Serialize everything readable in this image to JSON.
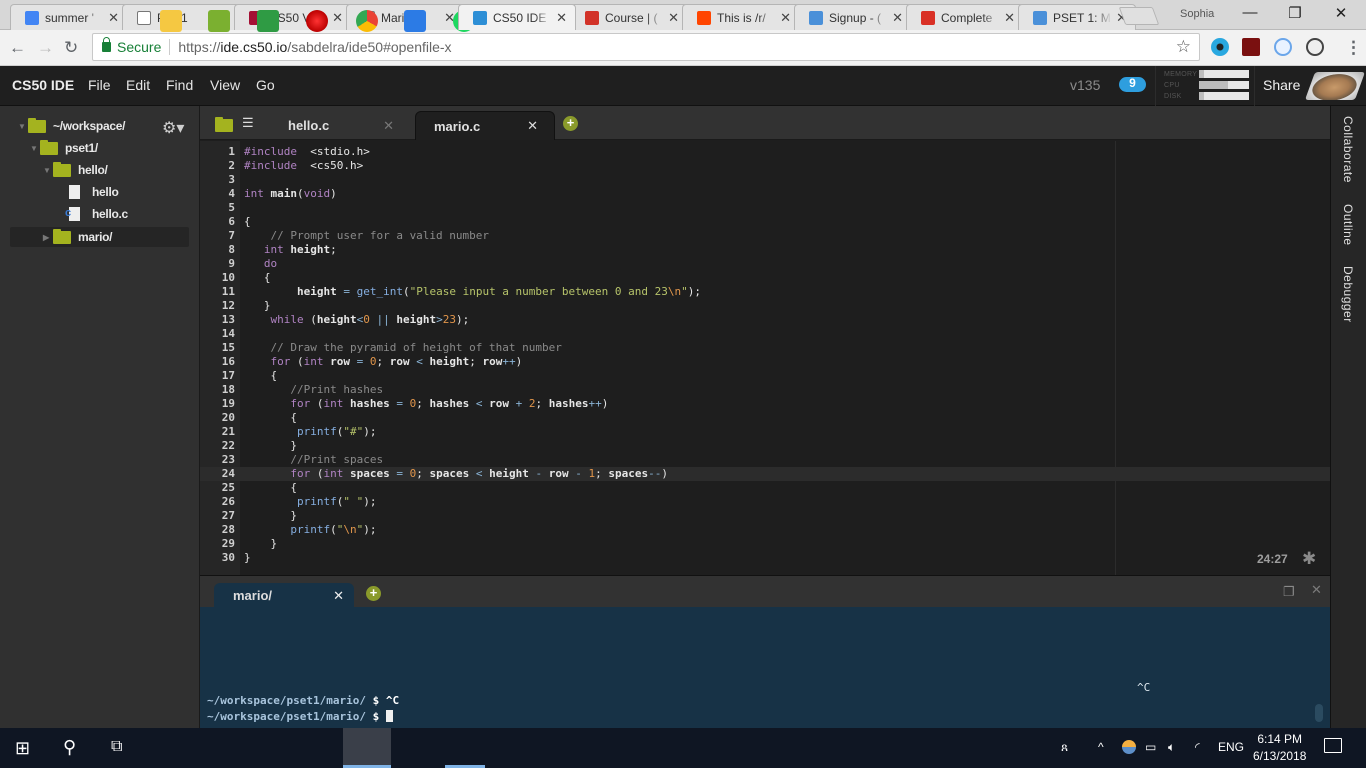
{
  "browser": {
    "tabs": [
      {
        "title": "summer '",
        "favicon": "docs-icon",
        "color": "#4285f4"
      },
      {
        "title": "Pset1",
        "favicon": "page-icon",
        "color": "#ffffff"
      },
      {
        "title": "CS50 Vide",
        "favicon": "harvard-shield-icon",
        "color": "#a41034"
      },
      {
        "title": "Mario",
        "favicon": "page-icon",
        "color": "#ffffff"
      },
      {
        "title": "CS50 IDE",
        "favicon": "cloud9-icon",
        "color": "#2e8fd6",
        "active": true
      },
      {
        "title": "Course | (",
        "favicon": "edx-icon",
        "color": "#d23228"
      },
      {
        "title": "This is /r/",
        "favicon": "reddit-icon",
        "color": "#ff4500"
      },
      {
        "title": "Signup - (",
        "favicon": "x-icon",
        "color": "#4a90d9"
      },
      {
        "title": "Complete",
        "favicon": "gmail-icon",
        "color": "#d93025"
      },
      {
        "title": "PSET 1: M",
        "favicon": "x-icon",
        "color": "#4a90d9"
      }
    ],
    "profile_name": "Sophia",
    "window_controls": {
      "minimize": "—",
      "maximize": "❐",
      "close": "✕"
    },
    "secure_label": "Secure",
    "url_prefix": "https://",
    "url_host": "ide.cs50.io",
    "url_path": "/sabdelra/ide50#openfile-x"
  },
  "ide": {
    "brand": "CS50 IDE",
    "menus": [
      "File",
      "Edit",
      "Find",
      "View",
      "Go"
    ],
    "version": "v135",
    "cloud_badge": "9",
    "meters": [
      {
        "label": "MEMORY",
        "value": 0.1
      },
      {
        "label": "CPU",
        "value": 0.58
      },
      {
        "label": "DISK",
        "value": 0.1
      }
    ],
    "share_label": "Share"
  },
  "tree": {
    "root": "~/workspace/",
    "items": [
      {
        "label": "pset1/",
        "type": "folder",
        "expanded": true
      },
      {
        "label": "hello/",
        "type": "folder",
        "expanded": true
      },
      {
        "label": "hello",
        "type": "file"
      },
      {
        "label": "hello.c",
        "type": "c-file"
      },
      {
        "label": "mario/",
        "type": "folder",
        "expanded": false,
        "selected": true
      }
    ]
  },
  "editor": {
    "tabs": [
      {
        "label": "hello.c",
        "active": false
      },
      {
        "label": "mario.c",
        "active": true
      }
    ],
    "cursor_position": "24:27",
    "active_line": 24,
    "lines": [
      "#include <stdio.h>",
      "#include <cs50.h>",
      "",
      "int main(void)",
      "",
      "{",
      "    // Prompt user for a valid number",
      "   int height;",
      "   do",
      "   {",
      "        height = get_int(\"Please input a number between 0 and 23\\n\");",
      "   }",
      "    while (height<0 || height>23);",
      "",
      "    // Draw the pyramid of height of that number",
      "    for (int row = 0; row < height; row++)",
      "    {",
      "       //Print hashes",
      "       for (int hashes = 0; hashes < row + 2; hashes++)",
      "       {",
      "        printf(\"#\");",
      "       }",
      "       //Print spaces",
      "       for (int spaces = 0; spaces < height - row - 1; spaces--)",
      "       {",
      "        printf(\" \");",
      "       }",
      "       printf(\"\\n\");",
      "    }",
      "}"
    ]
  },
  "right_panel": [
    "Collaborate",
    "Outline",
    "Debugger"
  ],
  "terminal": {
    "tab_label": "mario/",
    "floating_text": "^C",
    "lines": [
      {
        "prompt": "~/workspace/pset1/mario/",
        "symbol": "$",
        "input": "^C"
      },
      {
        "prompt": "~/workspace/pset1/mario/",
        "symbol": "$",
        "input": ""
      }
    ]
  },
  "taskbar": {
    "apps": [
      "start",
      "search",
      "task-view",
      "file-explorer",
      "cloud-app",
      "notes-app",
      "tomato-timer",
      "chrome",
      "scanner-app",
      "spotify"
    ],
    "language": "ENG",
    "time": "6:14 PM",
    "date": "6/13/2018"
  }
}
